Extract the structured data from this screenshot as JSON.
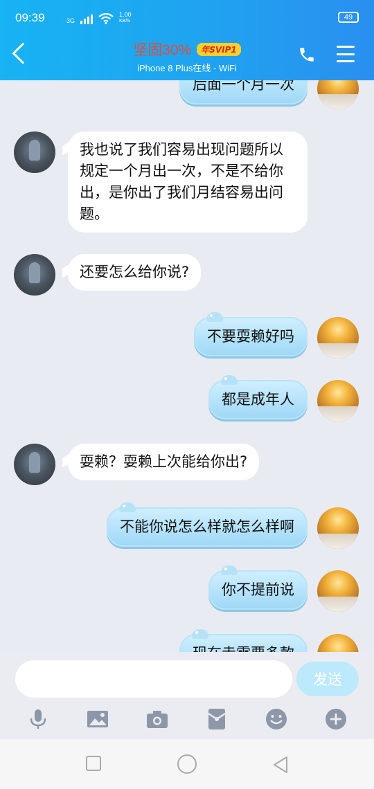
{
  "status_bar": {
    "time": "09:39",
    "network": "3G",
    "speed_value": "1.00",
    "speed_unit": "KB/S",
    "battery": "49"
  },
  "header": {
    "title": "坚固30%",
    "badge": "年SVIP1",
    "subtitle": "iPhone 8 Plus在线 - WiFi"
  },
  "messages": [
    {
      "side": "right",
      "text": "后面一个月一次"
    },
    {
      "side": "left",
      "text": "我也说了我们容易出现问题所以规定一个月出一次，不是不给你出，是你出了我们月结容易出问题。"
    },
    {
      "side": "left",
      "text": "还要怎么给你说?"
    },
    {
      "side": "right",
      "text": "不要耍赖好吗"
    },
    {
      "side": "right",
      "text": "都是成年人"
    },
    {
      "side": "left",
      "text": "耍赖？耍赖上次能给你出?"
    },
    {
      "side": "right",
      "text": "不能你说怎么样就怎么样啊"
    },
    {
      "side": "right",
      "text": "你不提前说"
    },
    {
      "side": "right",
      "text": "现在走需要多款"
    }
  ],
  "input": {
    "value": "",
    "send_label": "发送"
  },
  "colors": {
    "header_start": "#17b3f3",
    "header_end": "#2a8ff0",
    "title": "#e8493a",
    "badge_bg": "#ffcf2b",
    "right_bubble": "#9fd8f6",
    "send_button": "#bce9fb"
  },
  "toolbar_icons": [
    "microphone-icon",
    "image-icon",
    "camera-icon",
    "red-packet-icon",
    "emoji-icon",
    "plus-icon"
  ]
}
